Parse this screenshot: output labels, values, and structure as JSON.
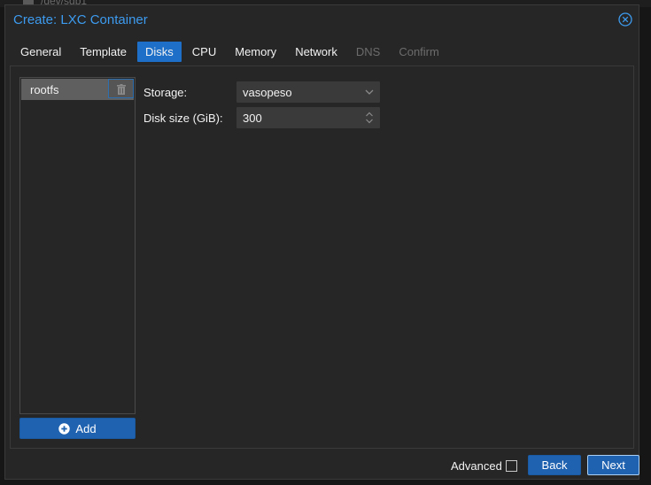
{
  "background": {
    "item_label": "/dev/sdb1"
  },
  "window": {
    "title": "Create: LXC Container",
    "accent_color": "#3d9bef"
  },
  "tabs": [
    {
      "label": "General",
      "state": "normal"
    },
    {
      "label": "Template",
      "state": "normal"
    },
    {
      "label": "Disks",
      "state": "active"
    },
    {
      "label": "CPU",
      "state": "normal"
    },
    {
      "label": "Memory",
      "state": "normal"
    },
    {
      "label": "Network",
      "state": "normal"
    },
    {
      "label": "DNS",
      "state": "disabled"
    },
    {
      "label": "Confirm",
      "state": "disabled"
    }
  ],
  "disks": {
    "items": [
      {
        "label": "rootfs",
        "selected": true
      }
    ],
    "add_label": "Add"
  },
  "form": {
    "storage_label": "Storage:",
    "storage_value": "vasopeso",
    "disk_size_label": "Disk size (GiB):",
    "disk_size_value": "300"
  },
  "footer": {
    "advanced_label": "Advanced",
    "advanced_checked": false,
    "back_label": "Back",
    "next_label": "Next"
  },
  "icons": {
    "close": "close-circle-icon",
    "trash": "trash-icon",
    "add": "plus-circle-icon",
    "dropdown": "chevron-down-icon",
    "spinner": "spinner-arrows-icon"
  }
}
